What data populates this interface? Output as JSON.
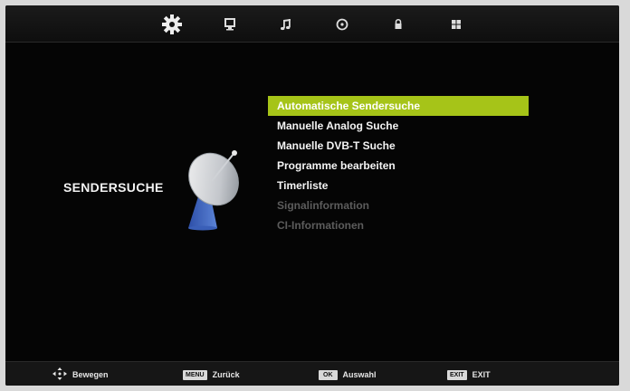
{
  "top_tabs": [
    {
      "icon": "gear-icon",
      "active": true
    },
    {
      "icon": "monitor-icon",
      "active": false
    },
    {
      "icon": "music-note-icon",
      "active": false
    },
    {
      "icon": "clock-icon",
      "active": false
    },
    {
      "icon": "lock-icon",
      "active": false
    },
    {
      "icon": "grid-icon",
      "active": false
    }
  ],
  "category": {
    "title": "SENDERSUCHE",
    "icon": "satellite-dish-icon"
  },
  "menu": {
    "items": [
      {
        "label": "Automatische Sendersuche",
        "state": "selected"
      },
      {
        "label": "Manuelle Analog Suche",
        "state": "enabled"
      },
      {
        "label": "Manuelle DVB-T Suche",
        "state": "enabled"
      },
      {
        "label": "Programme bearbeiten",
        "state": "enabled"
      },
      {
        "label": "Timerliste",
        "state": "enabled"
      },
      {
        "label": "Signalinformation",
        "state": "disabled"
      },
      {
        "label": "CI-Informationen",
        "state": "disabled"
      }
    ]
  },
  "footer": {
    "move": {
      "icon": "dpad-arrows-icon",
      "label": "Bewegen"
    },
    "back": {
      "key": "MENU",
      "label": "Zurück"
    },
    "select": {
      "key": "OK",
      "label": "Auswahl"
    },
    "exit": {
      "key": "EXIT",
      "label": "EXIT"
    }
  },
  "colors": {
    "highlight": "#a6c418",
    "background": "#050505",
    "disabled_text": "#5c5c5c"
  }
}
